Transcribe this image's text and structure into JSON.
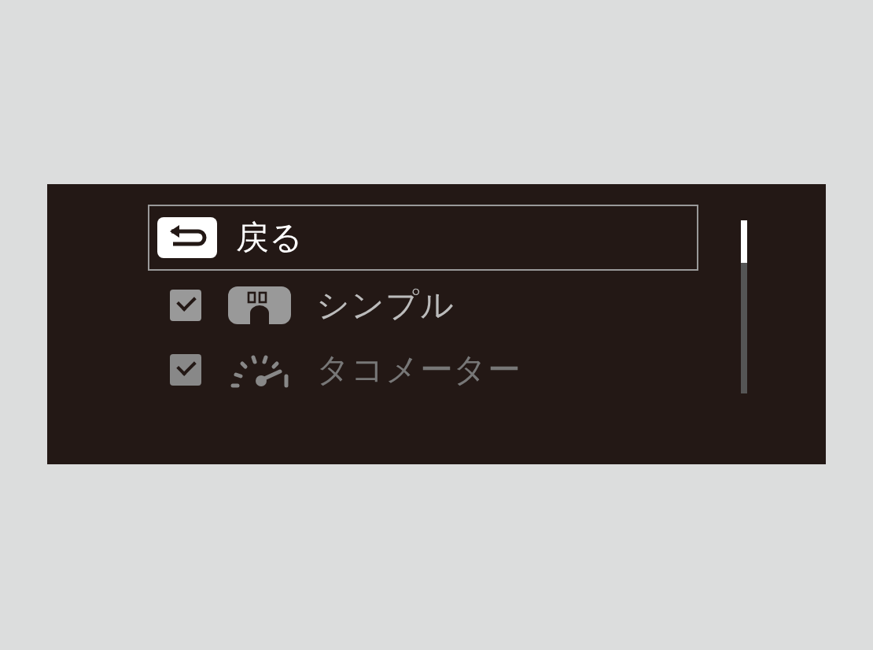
{
  "back_button": {
    "label": "戻る"
  },
  "items": [
    {
      "label": "シンプル",
      "kind": "digital",
      "checked": true,
      "disabled": false
    },
    {
      "label": "タコメーター",
      "kind": "tachometer",
      "checked": true,
      "disabled": true
    }
  ]
}
